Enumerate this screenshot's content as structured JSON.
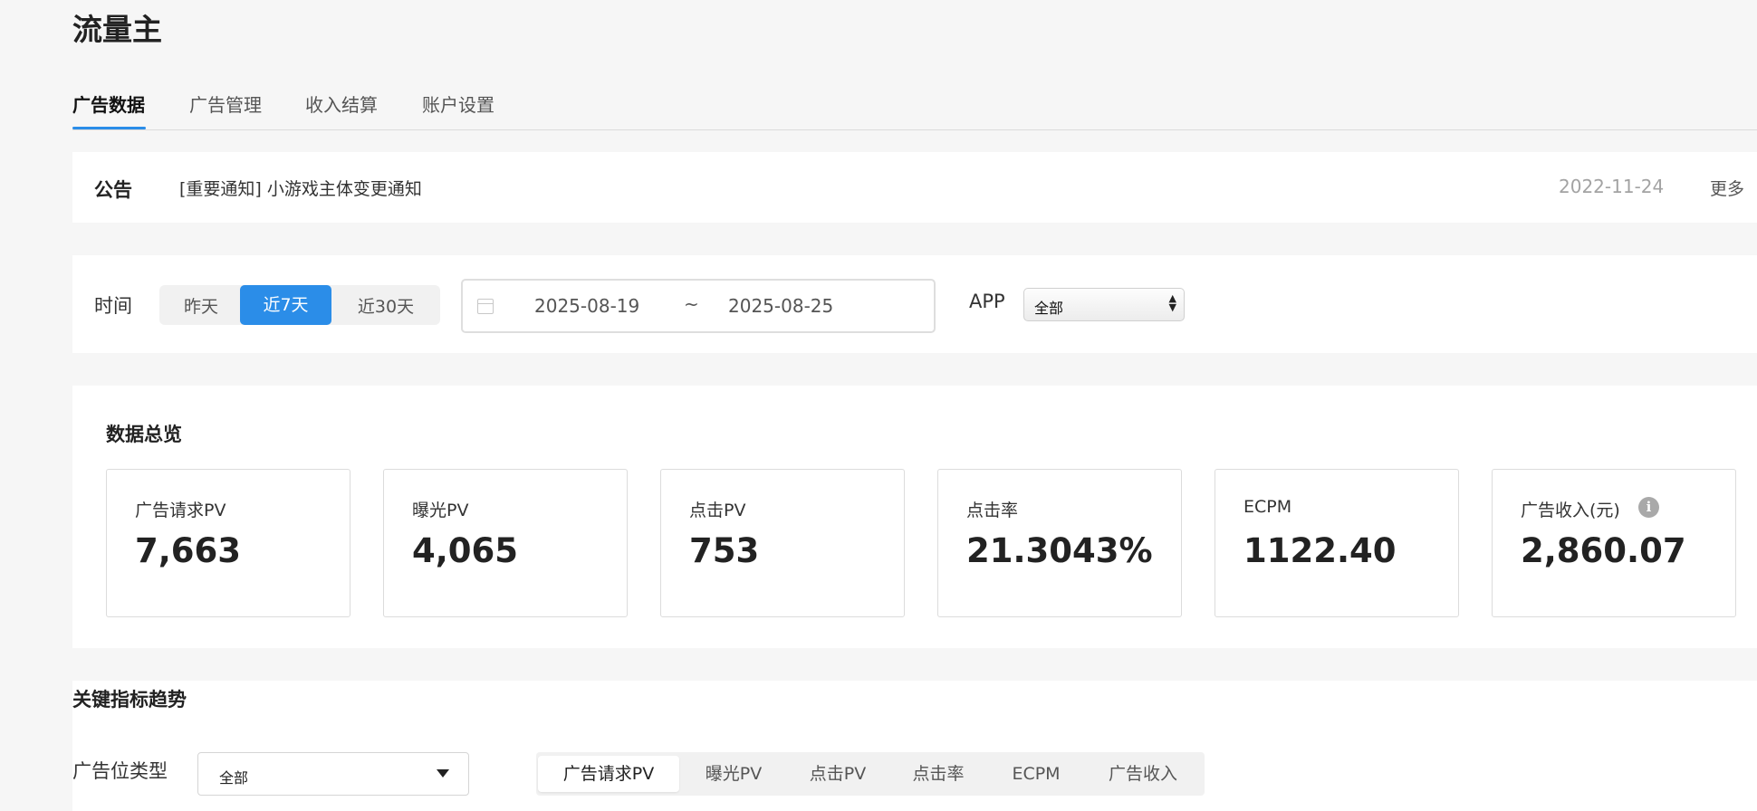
{
  "page": {
    "title": "流量主"
  },
  "tabs": [
    {
      "label": "广告数据",
      "active": true
    },
    {
      "label": "广告管理"
    },
    {
      "label": "收入结算"
    },
    {
      "label": "账户设置"
    }
  ],
  "notice": {
    "title": "公告",
    "text": "[重要通知] 小游戏主体变更通知",
    "date": "2022-11-24",
    "more": "更多"
  },
  "filter": {
    "time_label": "时间",
    "ranges": [
      {
        "label": "昨天"
      },
      {
        "label": "近7天",
        "active": true
      },
      {
        "label": "近30天"
      }
    ],
    "date_start": "2025-08-19",
    "date_sep": "~",
    "date_end": "2025-08-25",
    "app_label": "APP",
    "app_value": "全部"
  },
  "overview": {
    "title": "数据总览",
    "cards": [
      {
        "label": "广告请求PV",
        "value": "7,663"
      },
      {
        "label": "曝光PV",
        "value": "4,065"
      },
      {
        "label": "点击PV",
        "value": "753"
      },
      {
        "label": "点击率",
        "value": "21.3043%"
      },
      {
        "label": "ECPM",
        "value": "1122.40"
      },
      {
        "label": "广告收入(元)",
        "value": "2,860.07",
        "info_icon": "info-icon"
      }
    ]
  },
  "trend": {
    "title": "关键指标趋势",
    "type_label": "广告位类型",
    "type_value": "全部",
    "metrics": [
      {
        "label": "广告请求PV",
        "active": true
      },
      {
        "label": "曝光PV"
      },
      {
        "label": "点击PV"
      },
      {
        "label": "点击率"
      },
      {
        "label": "ECPM"
      },
      {
        "label": "广告收入"
      }
    ]
  },
  "colors": {
    "accent": "#2b8de8",
    "background": "#f6f6f6"
  }
}
